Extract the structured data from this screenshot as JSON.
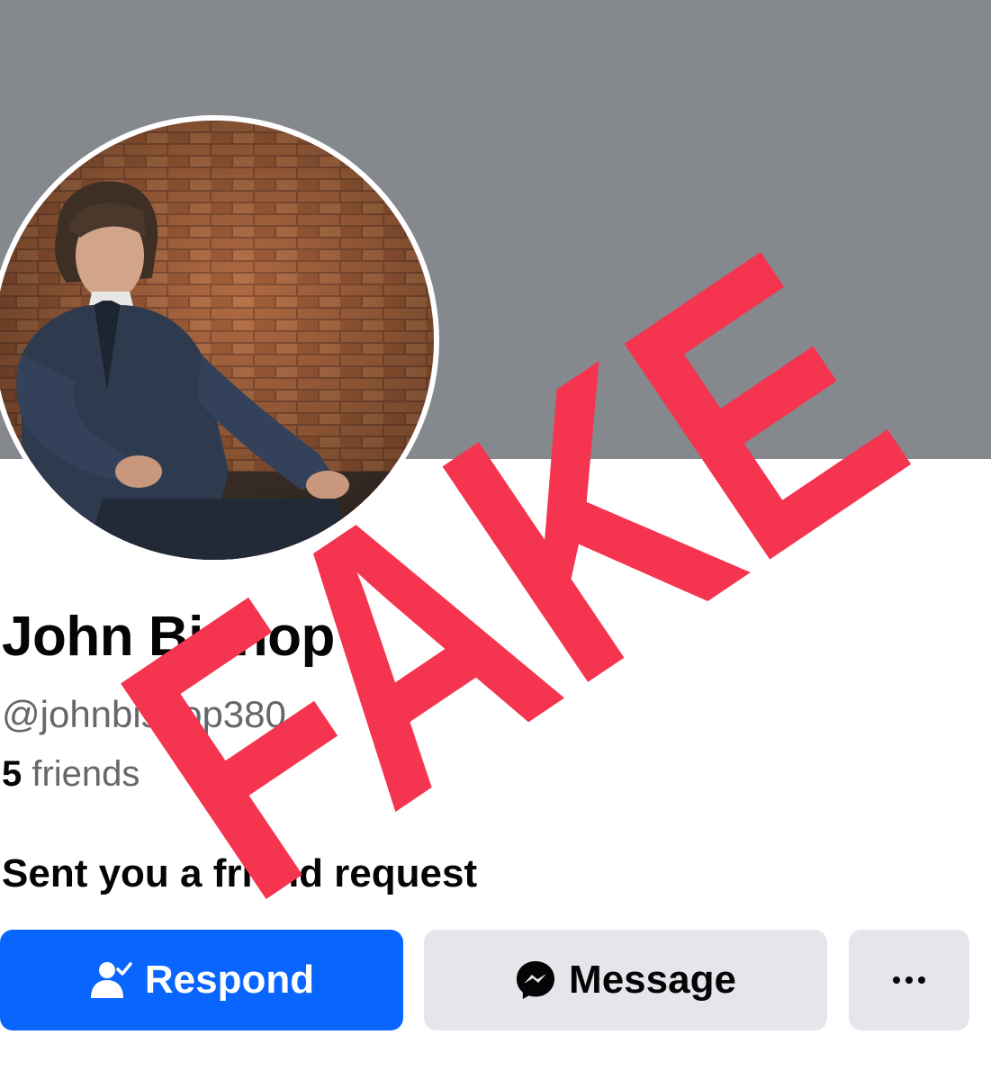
{
  "profile": {
    "name": "John Bishop",
    "username": "@johnbishop380",
    "friends_count": "5",
    "friends_label": " friends",
    "request_text": "Sent you a friend request"
  },
  "actions": {
    "respond_label": "Respond",
    "message_label": "Message",
    "more_label": "···"
  },
  "icons": {
    "respond": "person-check-icon",
    "message": "messenger-icon",
    "more": "more-dots-icon"
  },
  "overlay": {
    "stamp_text": "FAKE",
    "stamp_color": "#f5354f"
  },
  "colors": {
    "cover": "#85888d",
    "primary_button": "#0866ff",
    "secondary_button": "#e4e6eb",
    "secondary_text": "#65676b"
  }
}
